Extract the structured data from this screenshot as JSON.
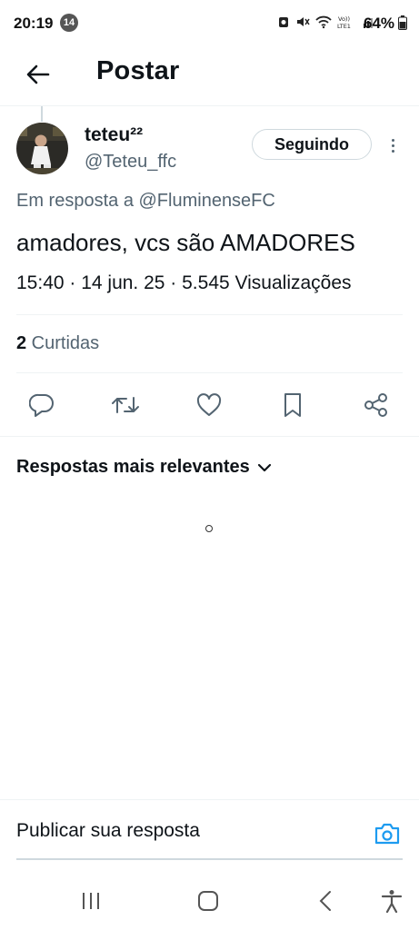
{
  "status_bar": {
    "time": "20:19",
    "notification_count": "14",
    "battery": "64%",
    "network_label": "Vo)) LTE1"
  },
  "header": {
    "title": "Postar"
  },
  "post": {
    "author_name": "teteu²²",
    "author_handle": "@Teteu_ffc",
    "follow_label": "Seguindo",
    "reply_to": "Em resposta a @FluminenseFC",
    "text": "amadores, vcs são AMADORES",
    "meta": "15:40 · 14 jun. 25 · 5.545 Visualizações",
    "likes_count": "2",
    "likes_label": " Curtidas"
  },
  "replies": {
    "sort_label": "Respostas mais relevantes"
  },
  "composer": {
    "placeholder": "Publicar sua resposta"
  },
  "icons": {
    "back": "arrow-left-icon",
    "more": "more-vertical-icon",
    "reply": "reply-icon",
    "retweet": "retweet-icon",
    "like": "heart-icon",
    "bookmark": "bookmark-icon",
    "share": "share-icon",
    "sort": "chevron-down-icon",
    "camera": "camera-icon"
  },
  "colors": {
    "text_primary": "#0f1419",
    "text_secondary": "#536471",
    "divider": "#eff3f4",
    "accent": "#1d9bf0"
  }
}
